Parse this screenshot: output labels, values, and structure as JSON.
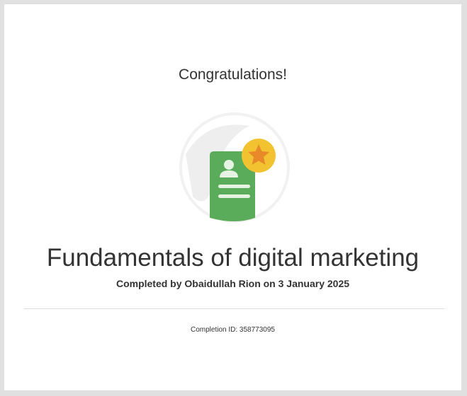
{
  "certificate": {
    "heading": "Congratulations!",
    "course_title": "Fundamentals of digital marketing",
    "completed_line": "Completed by Obaidullah Rion on 3 January 2025",
    "completion_id": "Completion ID: 358773095"
  },
  "badge": {
    "icon": "certificate-badge-icon",
    "colors": {
      "document": "#5aab5a",
      "star_circle": "#f2c230",
      "star": "#e8892a",
      "ring": "#eeeeee"
    }
  }
}
